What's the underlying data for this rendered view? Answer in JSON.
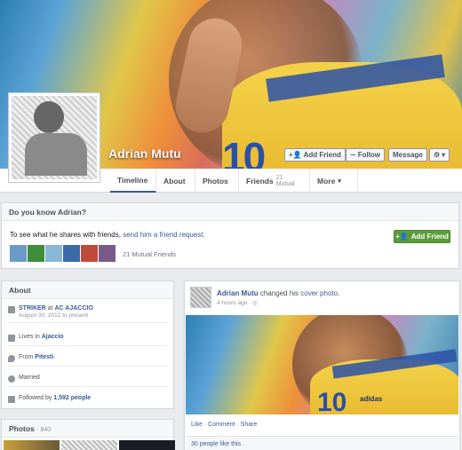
{
  "profile": {
    "name": "Adrian Mutu"
  },
  "cover_actions": {
    "add_friend": "Add Friend",
    "follow": "Follow",
    "message": "Message",
    "settings_icon": "gear-icon"
  },
  "tabs": [
    {
      "label": "Timeline"
    },
    {
      "label": "About"
    },
    {
      "label": "Photos"
    },
    {
      "label": "Friends",
      "count": "21 Mutual"
    },
    {
      "label": "More"
    }
  ],
  "know_box": {
    "title": "Do you know Adrian?",
    "text_prefix": "To see what he shares with friends, ",
    "request_link": "send him a friend request.",
    "add_friend": "Add Friend",
    "mutual_count": "21 Mutual Friends"
  },
  "about": {
    "title": "About",
    "job_title": "STRIKER",
    "job_sep": " at ",
    "job_company": "AC AJACCIO",
    "job_dates": "August 30, 2012 to present",
    "lives_prefix": "Lives in ",
    "lives_place": "Ajaccio",
    "from_prefix": "From ",
    "from_place": "Pitesti",
    "relationship": "Married",
    "followed_prefix": "Followed by ",
    "followed_count": "1,592 people"
  },
  "photos": {
    "title": "Photos",
    "count": "840"
  },
  "post": {
    "author": "Adrian Mutu",
    "action_prefix": " changed his ",
    "action_link": "cover photo",
    "action_suffix": ".",
    "time": "4 hours ago",
    "like": "Like",
    "comment": "Comment",
    "share": "Share",
    "likes_text": "30 people like this."
  },
  "colors": {
    "fb_blue": "#3b5998",
    "add_friend_green": "#5b9b3c",
    "bg": "#e9ebee"
  }
}
